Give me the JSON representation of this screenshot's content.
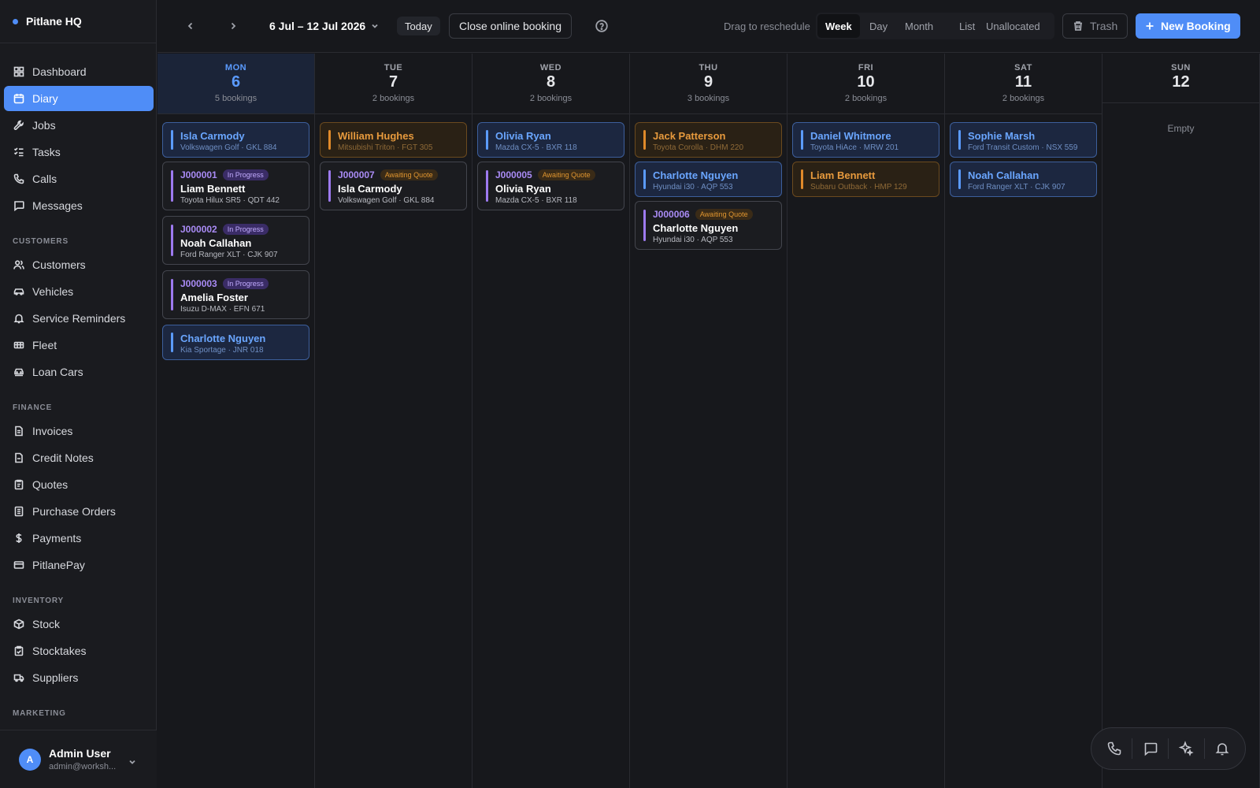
{
  "brand": {
    "name": "Pitlane HQ"
  },
  "sidebar": {
    "items": [
      {
        "label": "Dashboard",
        "icon": "dashboard-icon"
      },
      {
        "label": "Diary",
        "icon": "calendar-icon",
        "active": true
      },
      {
        "label": "Jobs",
        "icon": "wrench-icon"
      },
      {
        "label": "Tasks",
        "icon": "checklist-icon"
      },
      {
        "label": "Calls",
        "icon": "phone-icon"
      },
      {
        "label": "Messages",
        "icon": "message-icon"
      }
    ],
    "sections": [
      {
        "title": "CUSTOMERS",
        "items": [
          {
            "label": "Customers",
            "icon": "users-icon"
          },
          {
            "label": "Vehicles",
            "icon": "car-icon"
          },
          {
            "label": "Service Reminders",
            "icon": "bell-icon"
          },
          {
            "label": "Fleet",
            "icon": "truck-icon"
          },
          {
            "label": "Loan Cars",
            "icon": "loan-car-icon"
          }
        ]
      },
      {
        "title": "FINANCE",
        "items": [
          {
            "label": "Invoices",
            "icon": "invoice-icon"
          },
          {
            "label": "Credit Notes",
            "icon": "credit-note-icon"
          },
          {
            "label": "Quotes",
            "icon": "quote-icon"
          },
          {
            "label": "Purchase Orders",
            "icon": "purchase-order-icon"
          },
          {
            "label": "Payments",
            "icon": "dollar-icon"
          },
          {
            "label": "PitlanePay",
            "icon": "card-icon"
          }
        ]
      },
      {
        "title": "INVENTORY",
        "items": [
          {
            "label": "Stock",
            "icon": "box-icon"
          },
          {
            "label": "Stocktakes",
            "icon": "clipboard-icon"
          },
          {
            "label": "Suppliers",
            "icon": "delivery-icon"
          }
        ]
      },
      {
        "title": "MARKETING",
        "items": []
      }
    ]
  },
  "user": {
    "initial": "A",
    "name": "Admin User",
    "email": "admin@worksh..."
  },
  "toolbar": {
    "range": "6 Jul – 12 Jul 2026",
    "today_label": "Today",
    "close_booking_label": "Close online booking",
    "drag_hint": "Drag to reschedule",
    "views": [
      "Week",
      "Day",
      "Month",
      "List",
      "Unallocated"
    ],
    "active_view": "Week",
    "trash_label": "Trash",
    "new_booking_label": "New Booking"
  },
  "days": [
    {
      "name": "MON",
      "num": "6",
      "count": "5 bookings",
      "today": true,
      "cards": [
        {
          "type": "booking",
          "color": "blue",
          "name": "Isla Carmody",
          "sub": "Volkswagen Golf · GKL 884"
        },
        {
          "type": "job",
          "id": "J000001",
          "status": "In Progress",
          "name": "Liam Bennett",
          "sub": "Toyota Hilux SR5 · QDT 442"
        },
        {
          "type": "job",
          "id": "J000002",
          "status": "In Progress",
          "name": "Noah Callahan",
          "sub": "Ford Ranger XLT · CJK 907"
        },
        {
          "type": "job",
          "id": "J000003",
          "status": "In Progress",
          "name": "Amelia Foster",
          "sub": "Isuzu D-MAX · EFN 671"
        },
        {
          "type": "booking",
          "color": "blue",
          "name": "Charlotte Nguyen",
          "sub": "Kia Sportage · JNR 018"
        }
      ]
    },
    {
      "name": "TUE",
      "num": "7",
      "count": "2 bookings",
      "cards": [
        {
          "type": "booking",
          "color": "orange",
          "name": "William Hughes",
          "sub": "Mitsubishi Triton · FGT 305"
        },
        {
          "type": "job",
          "id": "J000007",
          "status": "Awaiting Quote",
          "name": "Isla Carmody",
          "sub": "Volkswagen Golf · GKL 884"
        }
      ]
    },
    {
      "name": "WED",
      "num": "8",
      "count": "2 bookings",
      "cards": [
        {
          "type": "booking",
          "color": "blue",
          "name": "Olivia Ryan",
          "sub": "Mazda CX-5 · BXR 118"
        },
        {
          "type": "job",
          "id": "J000005",
          "status": "Awaiting Quote",
          "name": "Olivia Ryan",
          "sub": "Mazda CX-5 · BXR 118"
        }
      ]
    },
    {
      "name": "THU",
      "num": "9",
      "count": "3 bookings",
      "cards": [
        {
          "type": "booking",
          "color": "orange",
          "name": "Jack Patterson",
          "sub": "Toyota Corolla · DHM 220"
        },
        {
          "type": "booking",
          "color": "blue",
          "name": "Charlotte Nguyen",
          "sub": "Hyundai i30 · AQP 553"
        },
        {
          "type": "job",
          "id": "J000006",
          "status": "Awaiting Quote",
          "name": "Charlotte Nguyen",
          "sub": "Hyundai i30 · AQP 553"
        }
      ]
    },
    {
      "name": "FRI",
      "num": "10",
      "count": "2 bookings",
      "cards": [
        {
          "type": "booking",
          "color": "blue",
          "name": "Daniel Whitmore",
          "sub": "Toyota HiAce · MRW 201"
        },
        {
          "type": "booking",
          "color": "orange",
          "name": "Liam Bennett",
          "sub": "Subaru Outback · HMP 129"
        }
      ]
    },
    {
      "name": "SAT",
      "num": "11",
      "count": "2 bookings",
      "cards": [
        {
          "type": "booking",
          "color": "blue",
          "name": "Sophie Marsh",
          "sub": "Ford Transit Custom · NSX 559"
        },
        {
          "type": "booking",
          "color": "blue",
          "name": "Noah Callahan",
          "sub": "Ford Ranger XLT · CJK 907"
        }
      ]
    },
    {
      "name": "SUN",
      "num": "12",
      "count": "",
      "empty_label": "Empty",
      "cards": []
    }
  ],
  "dock": [
    "phone-icon",
    "chat-icon",
    "sparkles-icon",
    "bell-icon"
  ],
  "colors": {
    "accent": "#4f8df7",
    "booking_blue": "#5b9bff",
    "booking_orange": "#e08a2a",
    "job_purple": "#9d7af0"
  }
}
